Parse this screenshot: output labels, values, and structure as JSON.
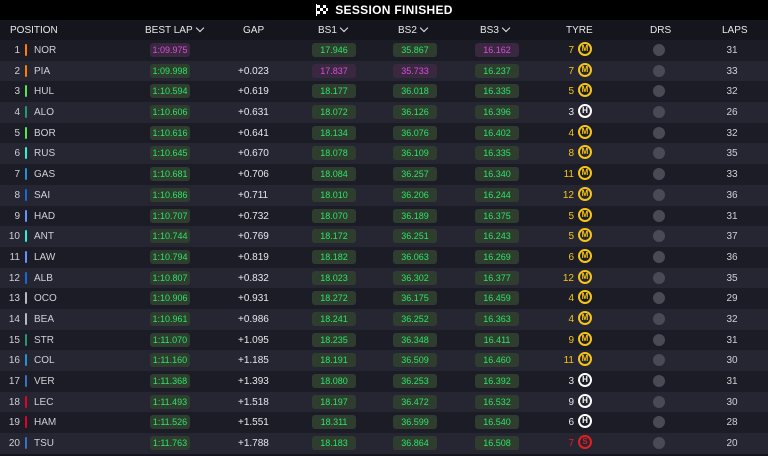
{
  "banner": {
    "title": "SESSION FINISHED"
  },
  "headers": {
    "position": "POSITION",
    "best_lap": "BEST LAP",
    "gap": "GAP",
    "bs1": "BS1",
    "bs2": "BS2",
    "bs3": "BS3",
    "tyre": "TYRE",
    "drs": "DRS",
    "laps": "LAPS"
  },
  "colors": {
    "green": "#2ee36a",
    "purple": "#d94fd9",
    "medium_tyre": "#f5c518",
    "hard_tyre": "#ffffff",
    "soft_tyre": "#e02020"
  },
  "rows": [
    {
      "pos": "1",
      "code": "NOR",
      "team_color": "#ff8000",
      "best_lap": "1:09.975",
      "lap_c": "p",
      "gap": "",
      "bs1": "17.946",
      "c1": "g",
      "bs2": "35.867",
      "c2": "g",
      "bs3": "16.162",
      "c3": "p",
      "tyre_count": "7",
      "tyre": "M",
      "laps": "31"
    },
    {
      "pos": "2",
      "code": "PIA",
      "team_color": "#ff8000",
      "best_lap": "1:09.998",
      "lap_c": "g",
      "gap": "+0.023",
      "bs1": "17.837",
      "c1": "p",
      "bs2": "35.733",
      "c2": "p",
      "bs3": "16.237",
      "c3": "g",
      "tyre_count": "7",
      "tyre": "M",
      "laps": "33"
    },
    {
      "pos": "3",
      "code": "HUL",
      "team_color": "#52e252",
      "best_lap": "1:10.594",
      "lap_c": "g",
      "gap": "+0.619",
      "bs1": "18.177",
      "c1": "g",
      "bs2": "36.018",
      "c2": "g",
      "bs3": "16.335",
      "c3": "g",
      "tyre_count": "5",
      "tyre": "M",
      "laps": "32"
    },
    {
      "pos": "4",
      "code": "ALO",
      "team_color": "#229971",
      "best_lap": "1:10.606",
      "lap_c": "g",
      "gap": "+0.631",
      "bs1": "18.072",
      "c1": "g",
      "bs2": "36.126",
      "c2": "g",
      "bs3": "16.396",
      "c3": "g",
      "tyre_count": "3",
      "tyre": "H",
      "laps": "26"
    },
    {
      "pos": "5",
      "code": "BOR",
      "team_color": "#52e252",
      "best_lap": "1:10.616",
      "lap_c": "g",
      "gap": "+0.641",
      "bs1": "18.134",
      "c1": "g",
      "bs2": "36.076",
      "c2": "g",
      "bs3": "16.402",
      "c3": "g",
      "tyre_count": "4",
      "tyre": "M",
      "laps": "32"
    },
    {
      "pos": "6",
      "code": "RUS",
      "team_color": "#27f4d2",
      "best_lap": "1:10.645",
      "lap_c": "g",
      "gap": "+0.670",
      "bs1": "18.078",
      "c1": "g",
      "bs2": "36.109",
      "c2": "g",
      "bs3": "16.335",
      "c3": "g",
      "tyre_count": "8",
      "tyre": "M",
      "laps": "35"
    },
    {
      "pos": "7",
      "code": "GAS",
      "team_color": "#2293d1",
      "best_lap": "1:10.681",
      "lap_c": "g",
      "gap": "+0.706",
      "bs1": "18.084",
      "c1": "g",
      "bs2": "36.257",
      "c2": "g",
      "bs3": "16.340",
      "c3": "g",
      "tyre_count": "11",
      "tyre": "M",
      "laps": "33"
    },
    {
      "pos": "8",
      "code": "SAI",
      "team_color": "#1868db",
      "best_lap": "1:10.686",
      "lap_c": "g",
      "gap": "+0.711",
      "bs1": "18.010",
      "c1": "g",
      "bs2": "36.206",
      "c2": "g",
      "bs3": "16.244",
      "c3": "g",
      "tyre_count": "12",
      "tyre": "M",
      "laps": "36"
    },
    {
      "pos": "9",
      "code": "HAD",
      "team_color": "#6692ff",
      "best_lap": "1:10.707",
      "lap_c": "g",
      "gap": "+0.732",
      "bs1": "18.070",
      "c1": "g",
      "bs2": "36.189",
      "c2": "g",
      "bs3": "16.375",
      "c3": "g",
      "tyre_count": "5",
      "tyre": "M",
      "laps": "31"
    },
    {
      "pos": "10",
      "code": "ANT",
      "team_color": "#27f4d2",
      "best_lap": "1:10.744",
      "lap_c": "g",
      "gap": "+0.769",
      "bs1": "18.172",
      "c1": "g",
      "bs2": "36.251",
      "c2": "g",
      "bs3": "16.243",
      "c3": "g",
      "tyre_count": "5",
      "tyre": "M",
      "laps": "37"
    },
    {
      "pos": "11",
      "code": "LAW",
      "team_color": "#6692ff",
      "best_lap": "1:10.794",
      "lap_c": "g",
      "gap": "+0.819",
      "bs1": "18.182",
      "c1": "g",
      "bs2": "36.063",
      "c2": "g",
      "bs3": "16.269",
      "c3": "g",
      "tyre_count": "6",
      "tyre": "M",
      "laps": "36"
    },
    {
      "pos": "12",
      "code": "ALB",
      "team_color": "#1868db",
      "best_lap": "1:10.807",
      "lap_c": "g",
      "gap": "+0.832",
      "bs1": "18.023",
      "c1": "g",
      "bs2": "36.302",
      "c2": "g",
      "bs3": "16.377",
      "c3": "g",
      "tyre_count": "12",
      "tyre": "M",
      "laps": "35"
    },
    {
      "pos": "13",
      "code": "OCO",
      "team_color": "#b6babd",
      "best_lap": "1:10.906",
      "lap_c": "g",
      "gap": "+0.931",
      "bs1": "18.272",
      "c1": "g",
      "bs2": "36.175",
      "c2": "g",
      "bs3": "16.459",
      "c3": "g",
      "tyre_count": "4",
      "tyre": "M",
      "laps": "29"
    },
    {
      "pos": "14",
      "code": "BEA",
      "team_color": "#b6babd",
      "best_lap": "1:10.961",
      "lap_c": "g",
      "gap": "+0.986",
      "bs1": "18.241",
      "c1": "g",
      "bs2": "36.252",
      "c2": "g",
      "bs3": "16.363",
      "c3": "g",
      "tyre_count": "4",
      "tyre": "M",
      "laps": "32"
    },
    {
      "pos": "15",
      "code": "STR",
      "team_color": "#229971",
      "best_lap": "1:11.070",
      "lap_c": "g",
      "gap": "+1.095",
      "bs1": "18.235",
      "c1": "g",
      "bs2": "36.348",
      "c2": "g",
      "bs3": "16.411",
      "c3": "g",
      "tyre_count": "9",
      "tyre": "M",
      "laps": "31"
    },
    {
      "pos": "16",
      "code": "COL",
      "team_color": "#2293d1",
      "best_lap": "1:11.160",
      "lap_c": "g",
      "gap": "+1.185",
      "bs1": "18.191",
      "c1": "g",
      "bs2": "36.509",
      "c2": "g",
      "bs3": "16.460",
      "c3": "g",
      "tyre_count": "11",
      "tyre": "M",
      "laps": "30"
    },
    {
      "pos": "17",
      "code": "VER",
      "team_color": "#3671c6",
      "best_lap": "1:11.368",
      "lap_c": "g",
      "gap": "+1.393",
      "bs1": "18.080",
      "c1": "g",
      "bs2": "36.253",
      "c2": "g",
      "bs3": "16.392",
      "c3": "g",
      "tyre_count": "3",
      "tyre": "H",
      "laps": "31"
    },
    {
      "pos": "18",
      "code": "LEC",
      "team_color": "#e8002d",
      "best_lap": "1:11.493",
      "lap_c": "g",
      "gap": "+1.518",
      "bs1": "18.197",
      "c1": "g",
      "bs2": "36.472",
      "c2": "g",
      "bs3": "16.532",
      "c3": "g",
      "tyre_count": "9",
      "tyre": "H",
      "laps": "30"
    },
    {
      "pos": "19",
      "code": "HAM",
      "team_color": "#e8002d",
      "best_lap": "1:11.526",
      "lap_c": "g",
      "gap": "+1.551",
      "bs1": "18.311",
      "c1": "g",
      "bs2": "36.599",
      "c2": "g",
      "bs3": "16.540",
      "c3": "g",
      "tyre_count": "6",
      "tyre": "H",
      "laps": "28"
    },
    {
      "pos": "20",
      "code": "TSU",
      "team_color": "#3671c6",
      "best_lap": "1:11.763",
      "lap_c": "g",
      "gap": "+1.788",
      "bs1": "18.183",
      "c1": "g",
      "bs2": "36.864",
      "c2": "g",
      "bs3": "16.508",
      "c3": "g",
      "tyre_count": "7",
      "tyre": "S",
      "laps": "20"
    }
  ]
}
